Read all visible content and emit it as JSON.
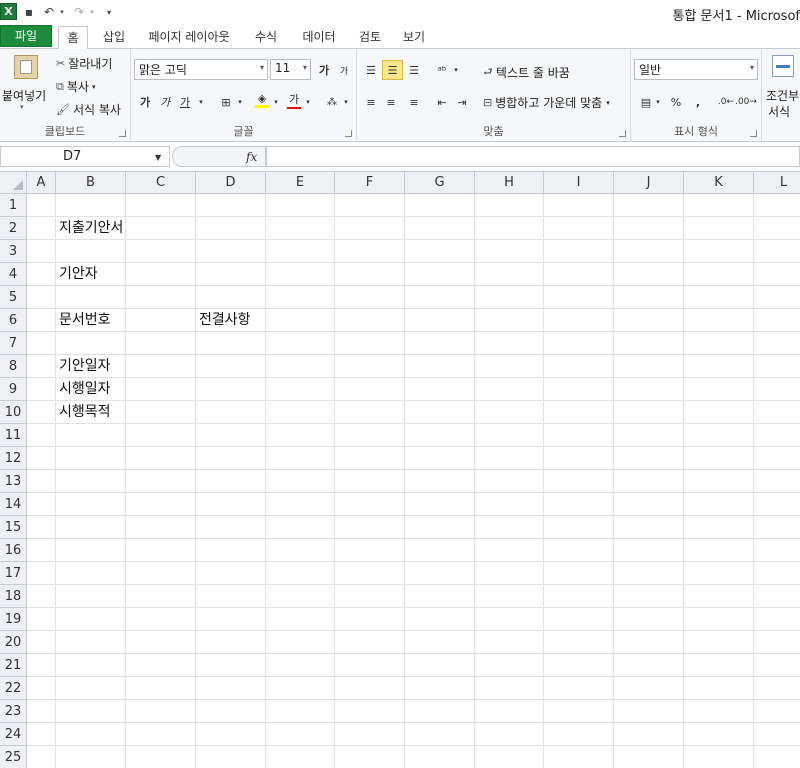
{
  "titlebar": {
    "title": "통합 문서1 - Microsof",
    "save_icon": "save-icon",
    "undo_icon": "undo-icon",
    "redo_icon": "redo-icon"
  },
  "tabs": [
    "파일",
    "홈",
    "삽입",
    "페이지 레이아웃",
    "수식",
    "데이터",
    "검토",
    "보기"
  ],
  "ribbon": {
    "clipboard": {
      "paste": "붙여넣기",
      "cut": "잘라내기",
      "copy": "복사",
      "format_painter": "서식 복사",
      "label": "클립보드"
    },
    "font": {
      "font_name": "맑은 고딕",
      "font_size": "11",
      "bold": "가",
      "italic": "가",
      "underline": "가",
      "font_color_glyph": "가",
      "label": "글꼴"
    },
    "alignment": {
      "wrap_text": "텍스트 줄 바꿈",
      "merge_center": "병합하고 가운데 맞춤",
      "label": "맞춤"
    },
    "number": {
      "format": "일반",
      "percent": "%",
      "comma": ",",
      "label": "표시 형식"
    },
    "styles": {
      "conditional_line1": "조건부",
      "conditional_line2": "서식"
    }
  },
  "formula_bar": {
    "name_box": "D7",
    "fx": "fx",
    "value": ""
  },
  "sheet": {
    "columns": [
      "A",
      "B",
      "C",
      "D",
      "E",
      "F",
      "G",
      "H",
      "I",
      "J",
      "K",
      "L"
    ],
    "rows": [
      "1",
      "2",
      "3",
      "4",
      "5",
      "6",
      "7",
      "8",
      "9",
      "10",
      "11",
      "12",
      "13",
      "14",
      "15",
      "16",
      "17",
      "18",
      "19",
      "20",
      "21",
      "22",
      "23",
      "24",
      "25"
    ],
    "cells": {
      "B2": "지출기안서",
      "B4": "기안자",
      "B6": "문서번호",
      "D6": "전결사항",
      "B8": "기안일자",
      "B9": "시행일자",
      "B10": "시행목적"
    }
  }
}
